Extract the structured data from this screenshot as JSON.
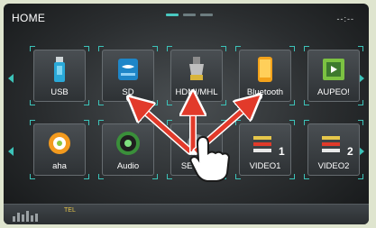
{
  "header": {
    "title": "HOME",
    "clock": "--:--"
  },
  "pager": {
    "pages": 3,
    "active": 0
  },
  "tiles": [
    {
      "label": "USB",
      "icon": "usb-drive-icon"
    },
    {
      "label": "SD",
      "icon": "sd-card-icon"
    },
    {
      "label": "HDMI/MHL",
      "icon": "hdmi-connector-icon"
    },
    {
      "label": "Bluetooth",
      "icon": "bluetooth-phone-icon"
    },
    {
      "label": "AUPEO!",
      "icon": "aupeo-icon"
    },
    {
      "label": "aha",
      "icon": "aha-icon"
    },
    {
      "label": "Audio",
      "icon": "speaker-icon"
    },
    {
      "label": "SET-UP",
      "icon": "setup-gear-icon"
    },
    {
      "label": "VIDEO1",
      "icon": "video-cables-icon"
    },
    {
      "label": "VIDEO2",
      "icon": "video-cables-icon"
    }
  ],
  "video_numbers": {
    "video1": "1",
    "video2": "2"
  },
  "bottom": {
    "tel": "TEL"
  },
  "colors": {
    "accent": "#3cc3b9",
    "arrow": "#e23a2a",
    "tel": "#e6c64a"
  }
}
